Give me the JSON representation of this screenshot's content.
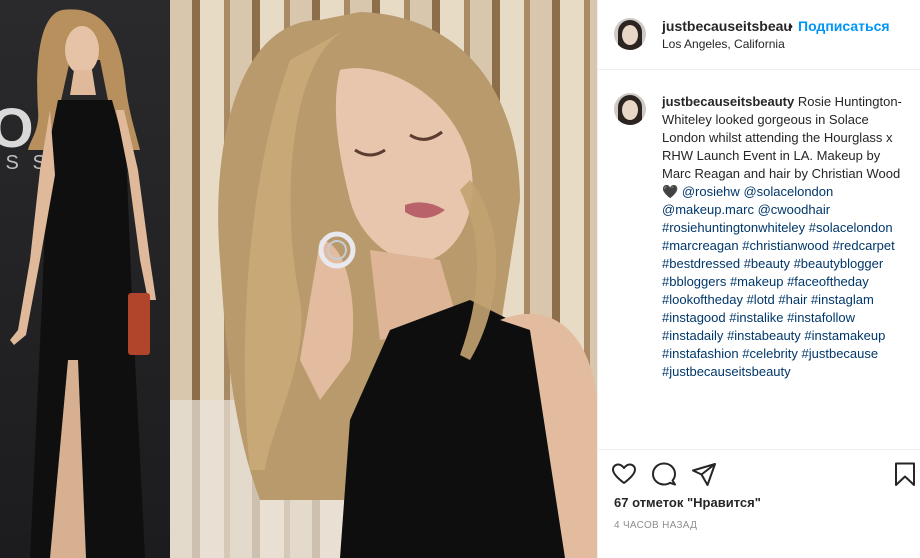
{
  "post": {
    "media_alt": "Rosie Huntington-Whiteley in black gown",
    "left_backdrop": "OGG",
    "left_backdrop_sub": "IS    SH"
  },
  "header": {
    "username": "justbecauseitsbeau",
    "separator": "•",
    "follow_label": "Подписаться",
    "location": "Los Angeles, California"
  },
  "caption": {
    "username": "justbecauseitsbeauty",
    "text": " Rosie Huntington-Whiteley looked gorgeous in Solace London whilst attending the Hourglass x RHW Launch Event in LA. Makeup by Marc Reagan and hair by Christian Wood 🖤",
    "mentions": [
      "@rosiehw",
      "@solacelondon",
      "@makeup.marc",
      "@cwoodhair"
    ],
    "hashtags": [
      "#rosiehuntingtonwhiteley",
      "#solacelondon",
      "#marcreagan",
      "#christianwood",
      "#redcarpet",
      "#bestdressed",
      "#beauty",
      "#beautyblogger",
      "#bbloggers",
      "#makeup",
      "#faceoftheday",
      "#lookoftheday",
      "#lotd",
      "#hair",
      "#instaglam",
      "#instagood",
      "#instalike",
      "#instafollow",
      "#instadaily",
      "#instabeauty",
      "#instamakeup",
      "#instafashion",
      "#celebrity",
      "#justbecause",
      "#justbecauseitsbeauty"
    ]
  },
  "actions": {
    "like_icon": "heart-outline-icon",
    "comment_icon": "comment-icon",
    "share_icon": "paper-plane-icon",
    "save_icon": "bookmark-icon",
    "likes_text": "67 отметок \"Нравится\"",
    "timestamp": "4 часов назад"
  },
  "colors": {
    "accent": "#0095f6",
    "tag": "#00376b",
    "text": "#262626",
    "muted": "#8e8e8e",
    "border": "#efefef"
  }
}
